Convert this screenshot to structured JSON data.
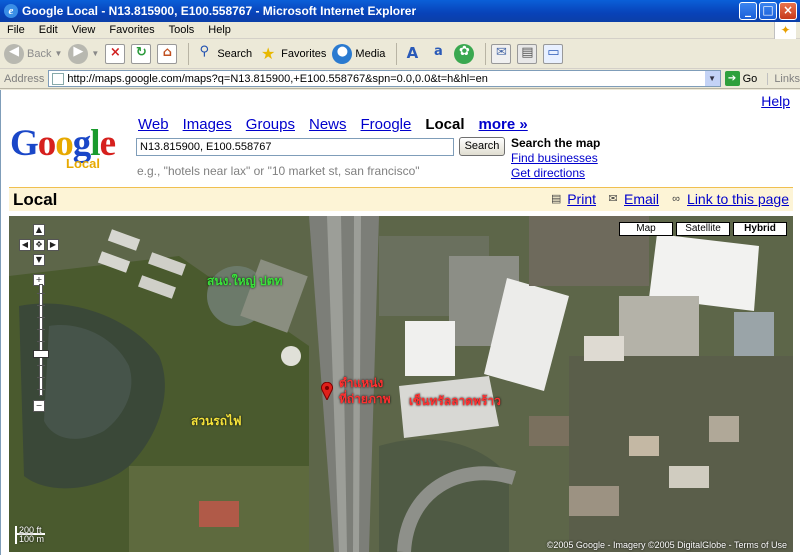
{
  "window": {
    "title": "Google Local - N13.815900, E100.558767 - Microsoft Internet Explorer",
    "minimize": "_",
    "maximize": "□",
    "close": "×"
  },
  "menu": [
    "File",
    "Edit",
    "View",
    "Favorites",
    "Tools",
    "Help"
  ],
  "toolbar": {
    "back": "Back",
    "search": "Search",
    "favorites": "Favorites",
    "media": "Media"
  },
  "address": {
    "label": "Address",
    "url": "http://maps.google.com/maps?q=N13.815900,+E100.558767&spn=0.0,0.0&t=h&hl=en",
    "go": "Go",
    "links": "Links"
  },
  "page": {
    "help": "Help",
    "logo_local": "Local",
    "nav": [
      "Web",
      "Images",
      "Groups",
      "News",
      "Froogle",
      "Local",
      "more »"
    ],
    "search_value": "N13.815900, E100.558767",
    "search_button": "Search",
    "hint": "e.g., \"hotels near lax\" or \"10 market st, san francisco\"",
    "search_the_map": "Search the map",
    "find_businesses": "Find businesses",
    "get_directions": "Get directions",
    "local_title": "Local",
    "print": "Print",
    "email": "Email",
    "link_to_page": "Link to this page"
  },
  "map": {
    "types": [
      "Map",
      "Satellite",
      "Hybrid"
    ],
    "selected_type": "Hybrid",
    "labels": {
      "label1": "สนง.ใหญ่ ปตท",
      "label2": "ตำแหน่ง",
      "label3": "ที่ถ่ายภาพ",
      "label4": "เซ็นทรัลลาดพร้าว",
      "label5": "สวนรถไฟ"
    },
    "scale_ft": "200 ft",
    "scale_m": "100 m",
    "copyright": "©2005 Google - Imagery ©2005 DigitalGlobe - Terms of Use",
    "colors": {
      "green_label": "#39e23a",
      "yellow_label": "#f5e23a",
      "red_label": "#ff3030",
      "marker": "#e0201a"
    }
  }
}
